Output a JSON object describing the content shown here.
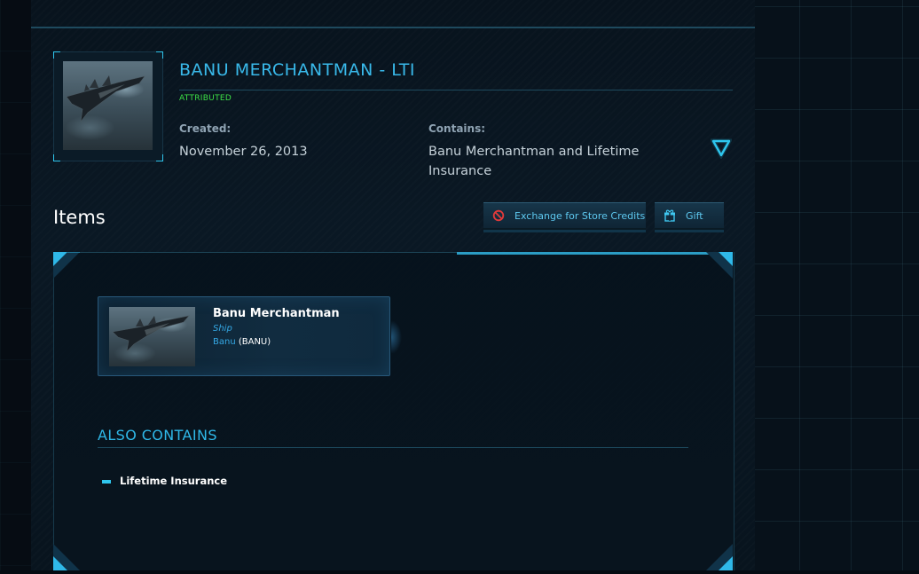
{
  "pledge": {
    "title": "BANU MERCHANTMAN - LTI",
    "status": "ATTRIBUTED",
    "created_label": "Created:",
    "created_value": "November 26, 2013",
    "contains_label": "Contains:",
    "contains_value": "Banu Merchantman and Lifetime Insurance",
    "image_icon": "ship-thumbnail",
    "toggle_icon": "triangle-down-icon"
  },
  "items_section": {
    "heading": "Items",
    "buttons": {
      "exchange_label": "Exchange for Store Credits",
      "exchange_icon": "no-entry-icon",
      "gift_label": "Gift",
      "gift_icon": "gift-box-icon"
    },
    "items": [
      {
        "name": "Banu Merchantman",
        "type": "Ship",
        "manufacturer": "Banu",
        "manufacturer_code": "BANU",
        "manufacturer_code_display": " (BANU)"
      }
    ],
    "also_contains": {
      "heading": "ALSO CONTAINS",
      "items": [
        "Lifetime Insurance"
      ]
    }
  },
  "colors": {
    "accent": "#39b9ea",
    "status_green": "#3de046",
    "background": "#08131d",
    "exchange_icon_red": "#e23a3a"
  }
}
